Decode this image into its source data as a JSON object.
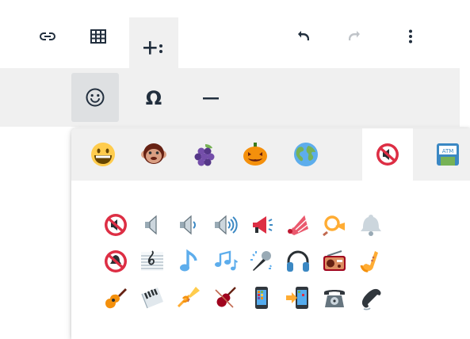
{
  "toolbar": {
    "row1": [
      "link-icon",
      "table-icon",
      "insert-more-icon",
      "undo-icon",
      "redo-icon",
      "more-vertical-icon"
    ],
    "row2": [
      "emoji-icon",
      "special-character-icon",
      "horizontal-line-icon"
    ],
    "special_character_label": "Ω",
    "colors": {
      "icon": "#222f3e",
      "disabled": "#c0c4c9",
      "bar_bg": "#f0f0f0",
      "active_bg": "#dee0e2"
    }
  },
  "emoji_panel": {
    "tabs": [
      {
        "name": "smileys-tab",
        "icon": "grinning-face-icon"
      },
      {
        "name": "animals-tab",
        "icon": "monkey-face-icon"
      },
      {
        "name": "food-tab",
        "icon": "grapes-icon"
      },
      {
        "name": "activities-tab",
        "icon": "jack-o-lantern-icon"
      },
      {
        "name": "travel-tab",
        "icon": "earth-globe-icon"
      },
      {
        "name": "objects-tab",
        "icon": "muted-speaker-icon",
        "active": true
      },
      {
        "name": "symbols-tab",
        "icon": "atm-sign-icon"
      }
    ],
    "emojis": [
      "muted-speaker-icon",
      "speaker-icon",
      "speaker-low-volume-icon",
      "speaker-high-volume-icon",
      "loudspeaker-icon",
      "megaphone-icon",
      "postal-horn-icon",
      "bell-icon",
      "bell-with-slash-icon",
      "musical-score-icon",
      "musical-note-icon",
      "musical-notes-icon",
      "microphone-icon",
      "headphone-icon",
      "radio-icon",
      "saxophone-icon",
      "guitar-icon",
      "musical-keyboard-icon",
      "trumpet-icon",
      "violin-icon",
      "mobile-phone-icon",
      "mobile-phone-with-arrow-icon",
      "telephone-icon",
      "telephone-receiver-icon"
    ]
  }
}
